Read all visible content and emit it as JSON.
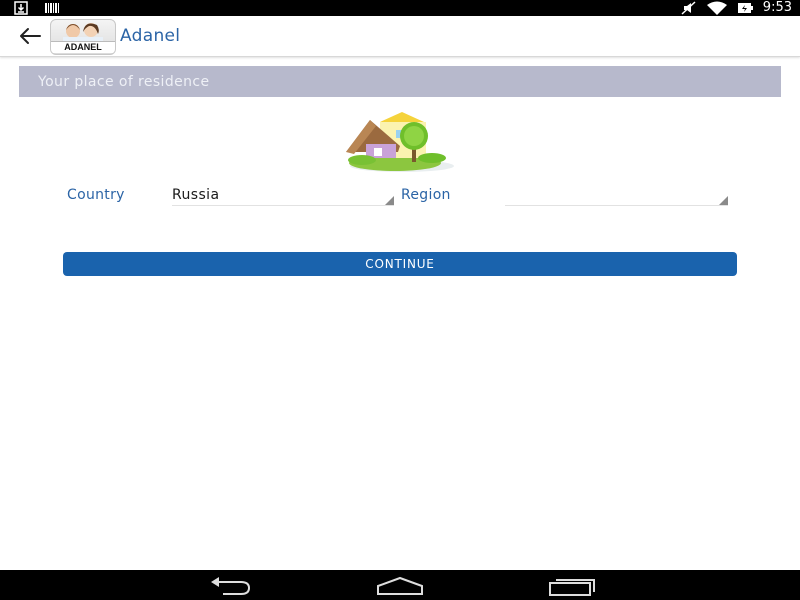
{
  "status_bar": {
    "time": "9:53",
    "icons": [
      "download-icon",
      "barcode-icon",
      "mute-icon",
      "wifi-icon",
      "battery-icon"
    ]
  },
  "app_bar": {
    "title": "Adanel",
    "logo_text": "ADANEL",
    "icons": [
      "back-arrow-icon",
      "app-logo-icon"
    ]
  },
  "section": {
    "header": "Your place of residence",
    "illustration": "house-icon"
  },
  "form": {
    "country_label": "Country",
    "country_value": "Russia",
    "region_label": "Region",
    "region_value": ""
  },
  "actions": {
    "continue_label": "CONTINUE"
  },
  "nav_bar": {
    "icons": [
      "nav-back-icon",
      "nav-home-icon",
      "nav-recents-icon"
    ]
  },
  "colors": {
    "accent": "#2b64a6",
    "button": "#1a63ad",
    "section_header_bg": "#b7b9cc"
  }
}
